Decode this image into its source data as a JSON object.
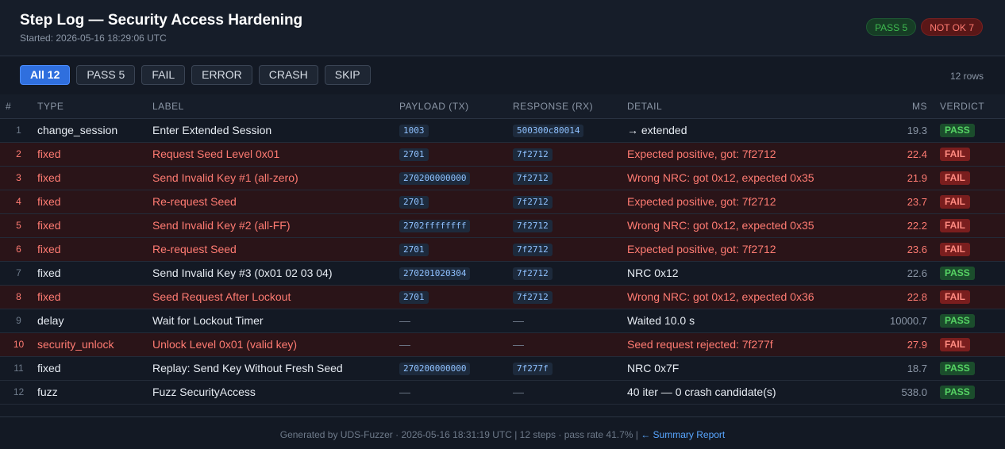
{
  "header": {
    "title": "Step Log — Security Access Hardening",
    "started": "Started: 2026-05-16 18:29:06 UTC",
    "badge_pass": "PASS 5",
    "badge_notok": "NOT OK 7"
  },
  "filters": {
    "all": "All 12",
    "pass": "PASS 5",
    "fail": "FAIL",
    "error": "ERROR",
    "crash": "CRASH",
    "skip": "SKIP",
    "row_count": "12 rows"
  },
  "columns": {
    "num": "#",
    "type": "TYPE",
    "label": "LABEL",
    "payload": "PAYLOAD (TX)",
    "response": "RESPONSE (RX)",
    "detail": "DETAIL",
    "ms": "MS",
    "verdict": "VERDICT"
  },
  "rows": [
    {
      "num": "1",
      "type": "change_session",
      "label": "Enter Extended Session",
      "payload": "1003",
      "response": "500300c80014",
      "detail": "→ extended",
      "ms": "19.3",
      "verdict": "PASS"
    },
    {
      "num": "2",
      "type": "fixed",
      "label": "Request Seed Level 0x01",
      "payload": "2701",
      "response": "7f2712",
      "detail": "Expected positive, got: 7f2712",
      "ms": "22.4",
      "verdict": "FAIL"
    },
    {
      "num": "3",
      "type": "fixed",
      "label": "Send Invalid Key #1 (all-zero)",
      "payload": "270200000000",
      "response": "7f2712",
      "detail": "Wrong NRC: got 0x12, expected 0x35",
      "ms": "21.9",
      "verdict": "FAIL"
    },
    {
      "num": "4",
      "type": "fixed",
      "label": "Re-request Seed",
      "payload": "2701",
      "response": "7f2712",
      "detail": "Expected positive, got: 7f2712",
      "ms": "23.7",
      "verdict": "FAIL"
    },
    {
      "num": "5",
      "type": "fixed",
      "label": "Send Invalid Key #2 (all-FF)",
      "payload": "2702ffffffff",
      "response": "7f2712",
      "detail": "Wrong NRC: got 0x12, expected 0x35",
      "ms": "22.2",
      "verdict": "FAIL"
    },
    {
      "num": "6",
      "type": "fixed",
      "label": "Re-request Seed",
      "payload": "2701",
      "response": "7f2712",
      "detail": "Expected positive, got: 7f2712",
      "ms": "23.6",
      "verdict": "FAIL"
    },
    {
      "num": "7",
      "type": "fixed",
      "label": "Send Invalid Key #3 (0x01 02 03 04)",
      "payload": "270201020304",
      "response": "7f2712",
      "detail": "NRC 0x12",
      "ms": "22.6",
      "verdict": "PASS"
    },
    {
      "num": "8",
      "type": "fixed",
      "label": "Seed Request After Lockout",
      "payload": "2701",
      "response": "7f2712",
      "detail": "Wrong NRC: got 0x12, expected 0x36",
      "ms": "22.8",
      "verdict": "FAIL"
    },
    {
      "num": "9",
      "type": "delay",
      "label": "Wait for Lockout Timer",
      "payload": "—",
      "response": "—",
      "detail": "Waited 10.0 s",
      "ms": "10000.7",
      "verdict": "PASS"
    },
    {
      "num": "10",
      "type": "security_unlock",
      "label": "Unlock Level 0x01 (valid key)",
      "payload": "—",
      "response": "—",
      "detail": "Seed request rejected: 7f277f",
      "ms": "27.9",
      "verdict": "FAIL"
    },
    {
      "num": "11",
      "type": "fixed",
      "label": "Replay: Send Key Without Fresh Seed",
      "payload": "270200000000",
      "response": "7f277f",
      "detail": "NRC 0x7F",
      "ms": "18.7",
      "verdict": "PASS"
    },
    {
      "num": "12",
      "type": "fuzz",
      "label": "Fuzz SecurityAccess",
      "payload": "—",
      "response": "—",
      "detail": "40 iter — 0 crash candidate(s)",
      "ms": "538.0",
      "verdict": "PASS"
    }
  ],
  "footer": {
    "text": "Generated by UDS-Fuzzer · 2026-05-16 18:31:19 UTC  |  12 steps · pass rate 41.7%  |",
    "link": "← Summary Report"
  },
  "colors": {
    "background": "#131924",
    "pass": "#3fb950",
    "fail": "#ff7b72",
    "accent": "#2f6fde"
  }
}
